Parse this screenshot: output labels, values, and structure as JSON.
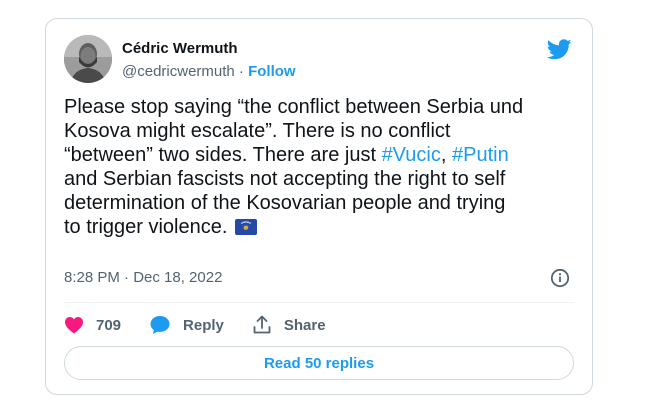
{
  "author": {
    "name": "Cédric Wermuth",
    "handle": "@cedricwermuth",
    "separator": " · ",
    "follow_label": "Follow"
  },
  "tweet": {
    "line1": "Please stop saying “the conflict between Serbia und",
    "line2": "Kosova might escalate”. There is no conflict",
    "line3": "“between” two sides. There are just ",
    "hashtag1": "#Vucic",
    "comma": ", ",
    "hashtag2": "#Putin",
    "line4": "and Serbian fascists not accepting the right to self",
    "line5": "determination of the Kosovarian people and trying",
    "line6": "to trigger violence. ",
    "flag_icon": "kosovo-flag-icon"
  },
  "timestamp": "8:28 PM · Dec 18, 2022",
  "actions": {
    "like_count": "709",
    "reply_label": "Reply",
    "share_label": "Share"
  },
  "read_replies_label": "Read 50 replies",
  "colors": {
    "accent": "#1d9bf0",
    "like": "#f91880",
    "text": "#0f1419",
    "secondary": "#536471",
    "border": "#cfd9de"
  },
  "icons": [
    "twitter-bird-icon",
    "info-icon",
    "heart-icon",
    "reply-bubble-icon",
    "share-icon",
    "kosovo-flag-icon"
  ]
}
